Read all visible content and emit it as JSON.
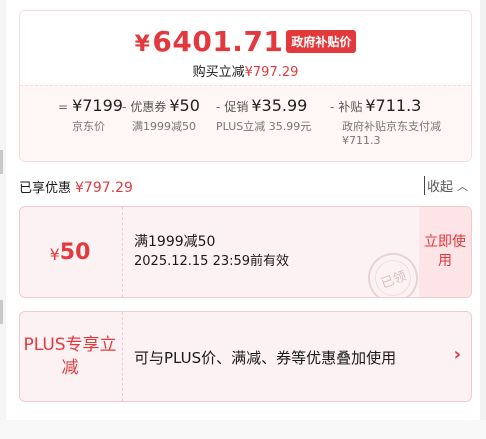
{
  "price": {
    "currency": "¥",
    "final": "6401.71",
    "gov_badge": "政府补贴价",
    "save_label": "购买立减",
    "save_amount": "¥797.29"
  },
  "formula": [
    {
      "op": "=",
      "prefix": "",
      "value": "¥7199",
      "label": "京东价"
    },
    {
      "op": "-",
      "prefix": "优惠券",
      "value": "¥50",
      "label": "满1999减50"
    },
    {
      "op": "-",
      "prefix": "促销",
      "value": "¥35.99",
      "label": "PLUS立减 35.99元"
    },
    {
      "op": "-",
      "prefix": "补贴",
      "value": "¥711.3",
      "label": "政府补贴京东支付减¥711.3"
    }
  ],
  "enjoyed": {
    "label": "已享优惠",
    "amount": "¥797.29",
    "collapse_label": "收起"
  },
  "coupon": {
    "currency": "¥",
    "amount": "50",
    "title": "满1999减50",
    "expiry": "2025.12.15 23:59前有效",
    "claim_label": "立即使用",
    "stamp_label": "已领"
  },
  "plus": {
    "tag": "PLUS专享立减",
    "description": "可与PLUS价、满减、券等优惠叠加使用"
  },
  "colors": {
    "accent": "#e4393c",
    "card_bg": "#fdf2f3",
    "claim_bg": "#fde4e6"
  },
  "icons": {
    "collapse": "chevron-up-icon",
    "plus_arrow": "chevron-right-icon"
  }
}
